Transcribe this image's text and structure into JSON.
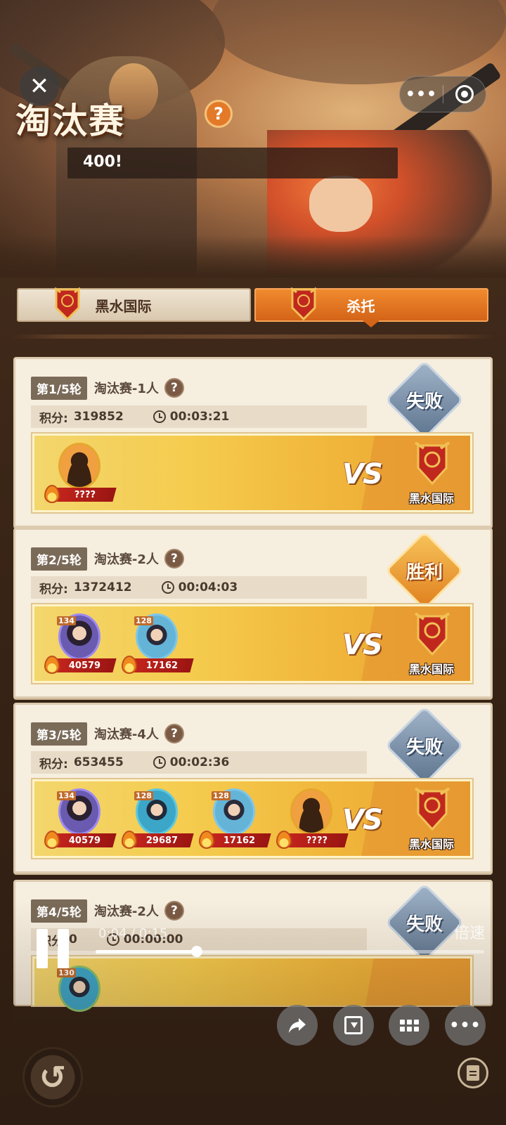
{
  "header": {
    "title": "淘汰赛",
    "help_icon": "?",
    "ribbon_text": "400!"
  },
  "window": {
    "close_icon": "✕",
    "more_icon": "•••"
  },
  "tabs": [
    {
      "label": "黑水国际",
      "active": false
    },
    {
      "label": "杀托",
      "active": true
    }
  ],
  "rounds": [
    {
      "round_label": "第1/5轮",
      "mode": "淘汰赛-1人",
      "score_label": "积分:",
      "score": "319852",
      "time": "00:03:21",
      "result": "失败",
      "players": [
        {
          "power": "????"
        }
      ],
      "vs": "VS",
      "opponent": "黑水国际"
    },
    {
      "round_label": "第2/5轮",
      "mode": "淘汰赛-2人",
      "score_label": "积分:",
      "score": "1372412",
      "time": "00:04:03",
      "result": "胜利",
      "players": [
        {
          "level": "134",
          "power": "40579"
        },
        {
          "level": "128",
          "power": "17162"
        }
      ],
      "vs": "VS",
      "opponent": "黑水国际"
    },
    {
      "round_label": "第3/5轮",
      "mode": "淘汰赛-4人",
      "score_label": "积分:",
      "score": "653455",
      "time": "00:02:36",
      "result": "失败",
      "players": [
        {
          "level": "134",
          "power": "40579"
        },
        {
          "level": "128",
          "power": "29687"
        },
        {
          "level": "128",
          "power": "17162"
        },
        {
          "power": "????"
        }
      ],
      "vs": "VS",
      "opponent": "黑水国际"
    },
    {
      "round_label": "第4/5轮",
      "mode": "淘汰赛-2人",
      "score_label": "积分",
      "score": "0",
      "time": "00:00:00",
      "result": "失败",
      "players": [
        {
          "level": "130"
        }
      ]
    }
  ],
  "video": {
    "time_text": "0:04 / 0:15",
    "speed_label": "倍速",
    "progress_fraction": 0.26
  },
  "bottom": {
    "back_icon": "↺"
  },
  "colors": {
    "accent": "#e27a2a",
    "win": "#f0a23a",
    "lose": "#7f95ad",
    "panel": "#f6eedf"
  }
}
